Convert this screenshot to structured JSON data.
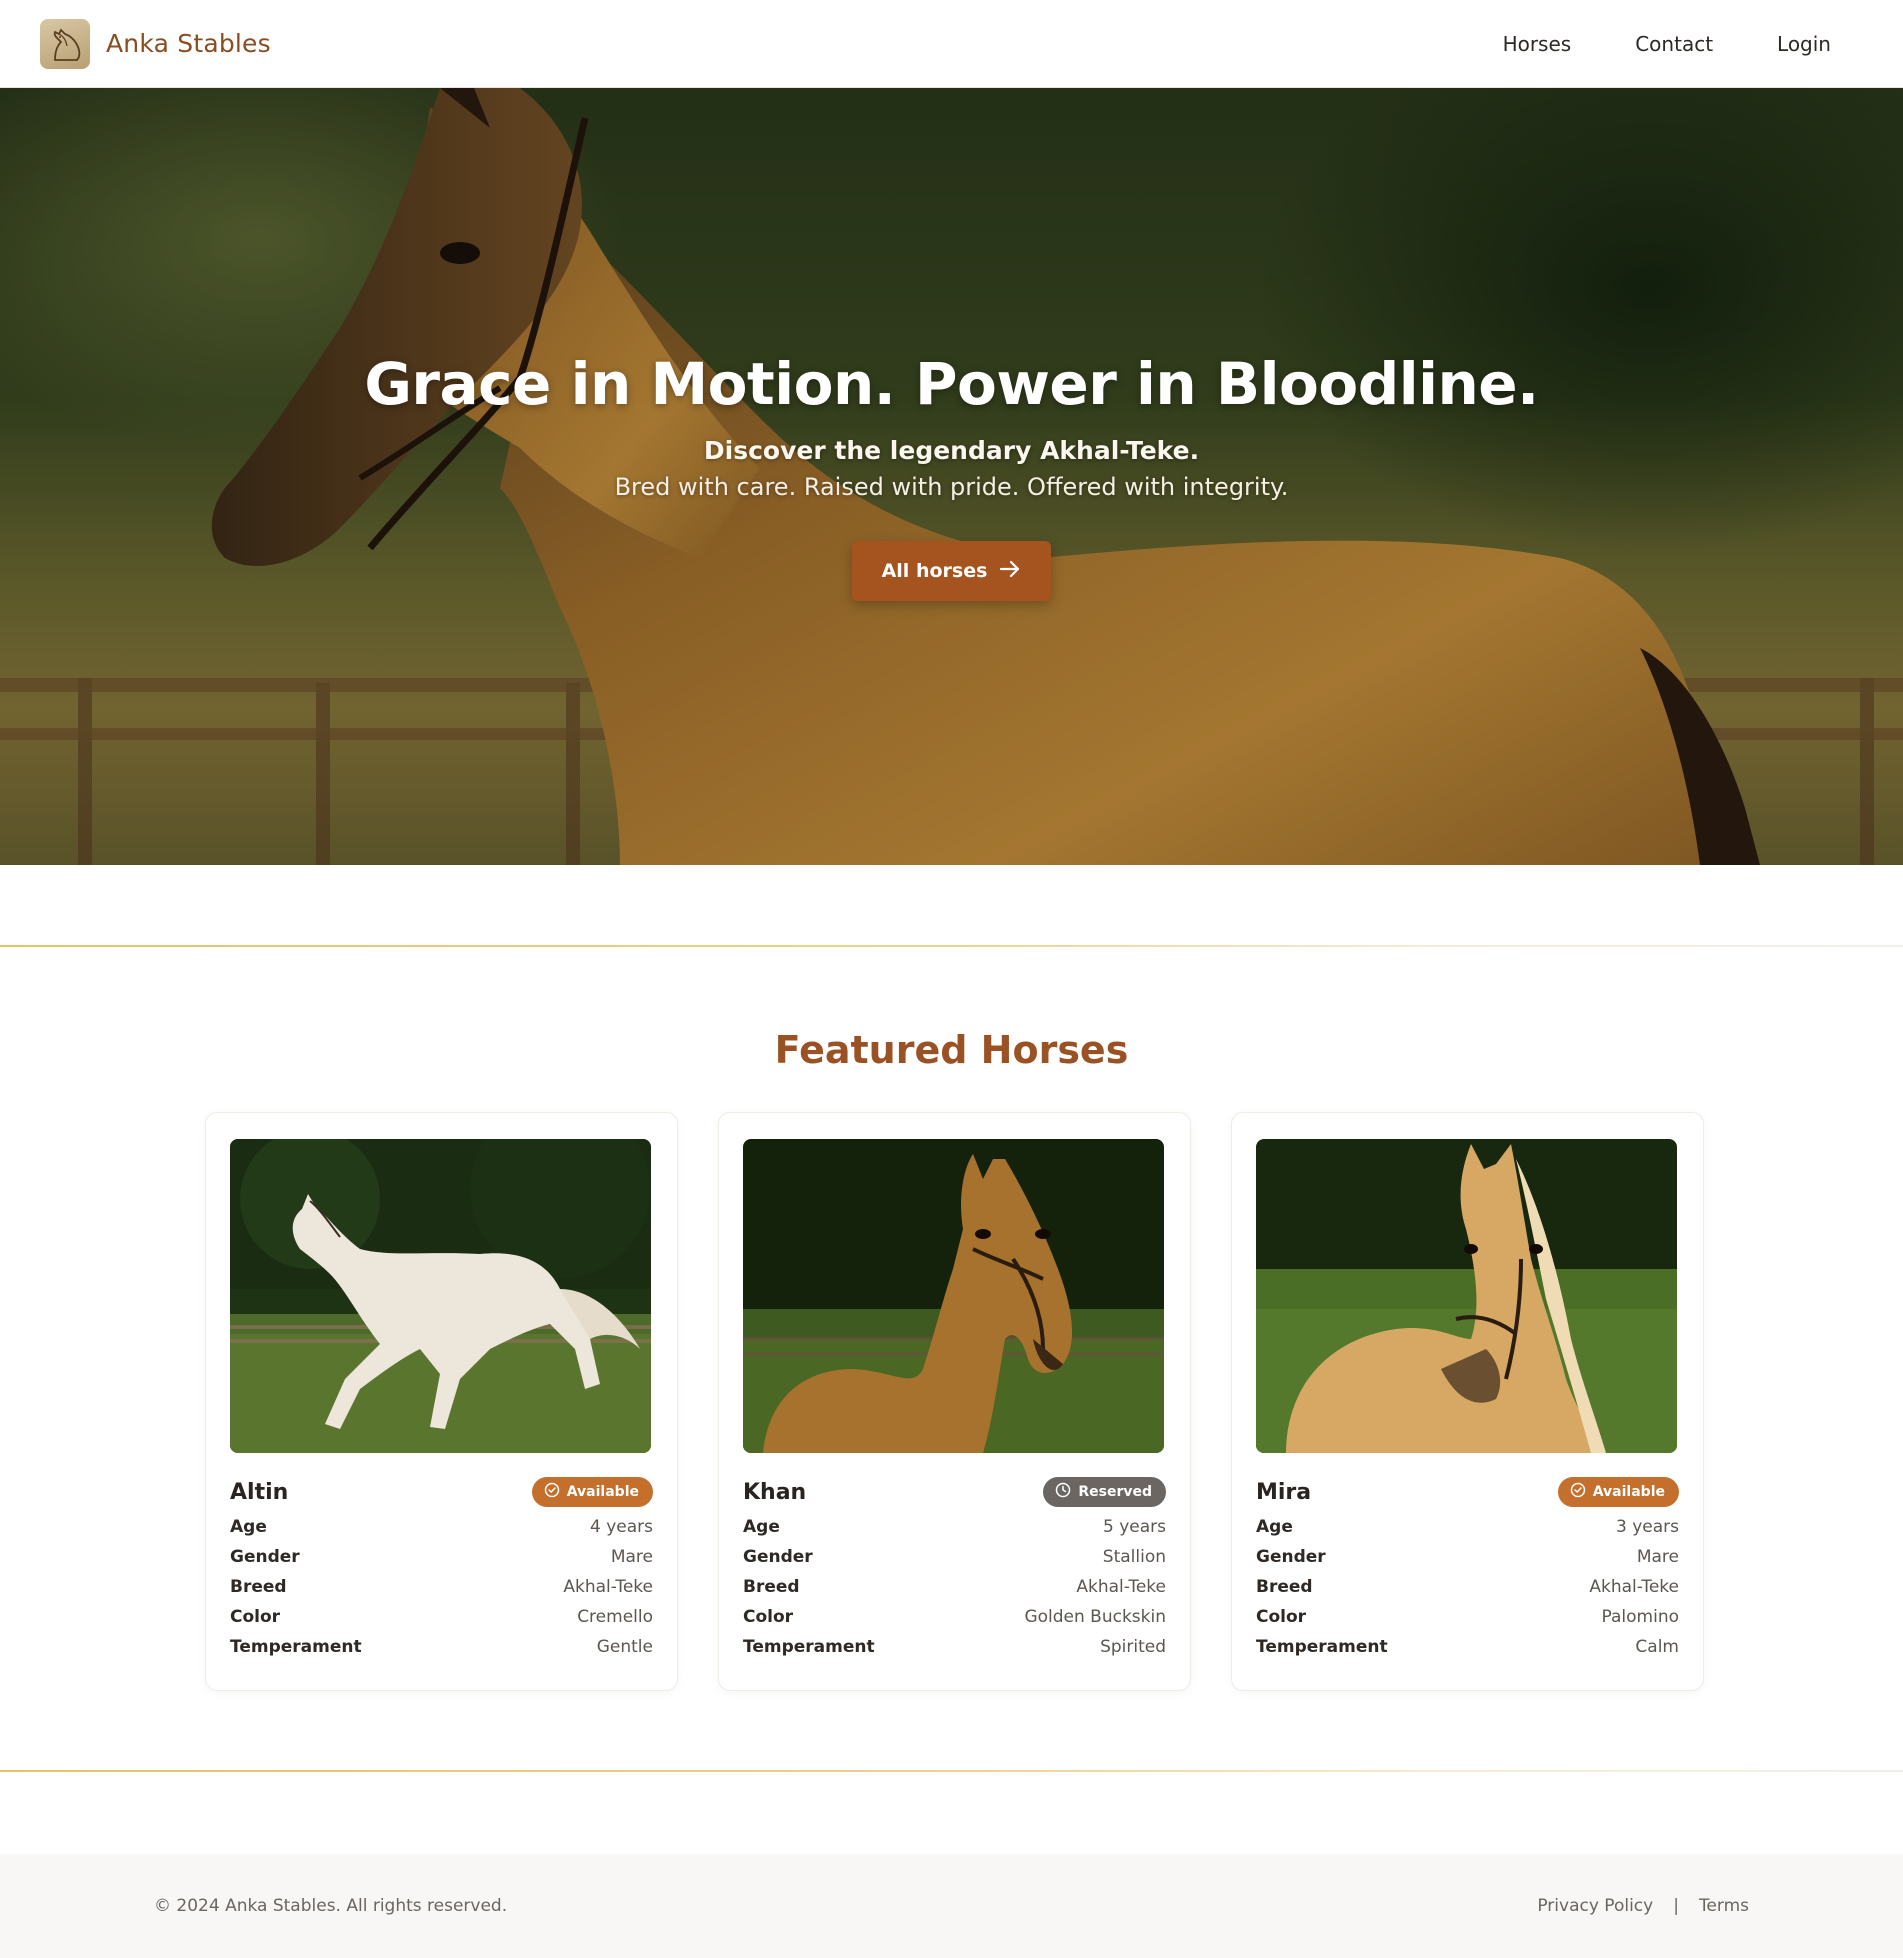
{
  "header": {
    "brand": "Anka Stables",
    "logo_icon": "horse-head-icon",
    "nav": [
      {
        "label": "Horses"
      },
      {
        "label": "Contact"
      },
      {
        "label": "Login"
      }
    ]
  },
  "hero": {
    "title": "Grace in Motion. Power in Bloodline.",
    "subtitle": "Discover the legendary Akhal-Teke.",
    "tagline": "Bred with care. Raised with pride. Offered with integrity.",
    "button_label": "All horses",
    "button_icon": "arrow-right-icon",
    "accent": "#a5541f"
  },
  "featured": {
    "title": "Featured Horses",
    "labels": {
      "age": "Age",
      "gender": "Gender",
      "breed": "Breed",
      "color": "Color",
      "temperament": "Temperament"
    },
    "horses": [
      {
        "name": "Altin",
        "status": "Available",
        "status_icon": "check-circle-icon",
        "status_color": "#c46f2b",
        "age": "4 years",
        "gender": "Mare",
        "breed": "Akhal-Teke",
        "color": "Cremello",
        "temperament": "Gentle"
      },
      {
        "name": "Khan",
        "status": "Reserved",
        "status_icon": "clock-icon",
        "status_color": "#6b6661",
        "age": "5 years",
        "gender": "Stallion",
        "breed": "Akhal-Teke",
        "color": "Golden Buckskin",
        "temperament": "Spirited"
      },
      {
        "name": "Mira",
        "status": "Available",
        "status_icon": "check-circle-icon",
        "status_color": "#c46f2b",
        "age": "3 years",
        "gender": "Mare",
        "breed": "Akhal-Teke",
        "color": "Palomino",
        "temperament": "Calm"
      }
    ]
  },
  "footer": {
    "copyright": "© 2024 Anka Stables. All rights reserved.",
    "links": [
      {
        "label": "Privacy Policy"
      },
      {
        "label": "Terms"
      }
    ],
    "separator": "|"
  }
}
